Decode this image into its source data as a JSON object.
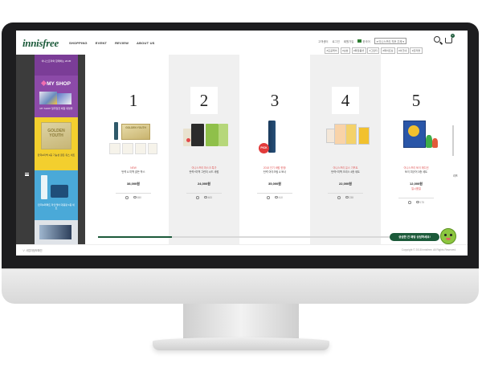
{
  "header": {
    "logo": "innisfree",
    "nav": [
      "SHOPPING",
      "EVENT",
      "REVIEW",
      "ABOUT US"
    ],
    "util_links": [
      "고객센터",
      "로그인",
      "회원가입"
    ],
    "language": "한국어",
    "myshop_select": "▾ 이니스프리 직후 주제 ▾",
    "cart_count": "0",
    "tags": [
      "#모공케어",
      "#보습",
      "#화장품셋",
      "#그린티",
      "#화이트닝",
      "#아크네",
      "#트러블"
    ]
  },
  "left_panel": {
    "banner1": "이니스프리와 함께하는 2018!",
    "myshop_title": "MY SHOP",
    "myshop_text": "MY SHOP 일주일전 체험 대영을",
    "golden_box": "GOLDEN YOUTH",
    "golden_text": "탄력&미백 2중 기능성 골든 유스 세트",
    "banner4_text": "탄력&퍼펙트 라인케어 대용량 4종 세트"
  },
  "products": [
    {
      "rank": "1",
      "promo": "NEW",
      "name": "탄력 & 미백 골든 박스",
      "price": "38,000원",
      "sub": "",
      "reviews": "650"
    },
    {
      "rank": "2",
      "promo": "이니스프리 마스크 특가",
      "name": "탄력+미백 그린티 씨드 세럼",
      "price": "24,000원",
      "sub": "",
      "reviews": "483"
    },
    {
      "rank": "3",
      "promo": "2018 인기 세럼 한정!",
      "name": "탄력 아이크림 & 토너",
      "price": "35,000원",
      "sub": "",
      "reviews": "410"
    },
    {
      "rank": "4",
      "promo": "이니스프리 유스 기프트",
      "name": "탄력+미백 크리스 4종 세트",
      "price": "22,000원",
      "sub": "",
      "reviews": "238"
    },
    {
      "rank": "5",
      "promo": "이니스프리 토이 에디션",
      "name": "토이 피규어 3종 세트",
      "price": "12,000원",
      "sub": "일시품절",
      "reviews": "175"
    }
  ],
  "partial_product": "리프",
  "progress_fraction": 0.22,
  "cta": "궁금한 건 채팅 상담하세요!",
  "footer": {
    "left": "∨ 사업자정보확인",
    "right": "Copyright © 2018 innisfree. All Rights Reserved."
  },
  "colors": {
    "brand_green": "#1c5a3a",
    "price_red": "#e05555",
    "panel_dark": "#3c3c3c"
  }
}
